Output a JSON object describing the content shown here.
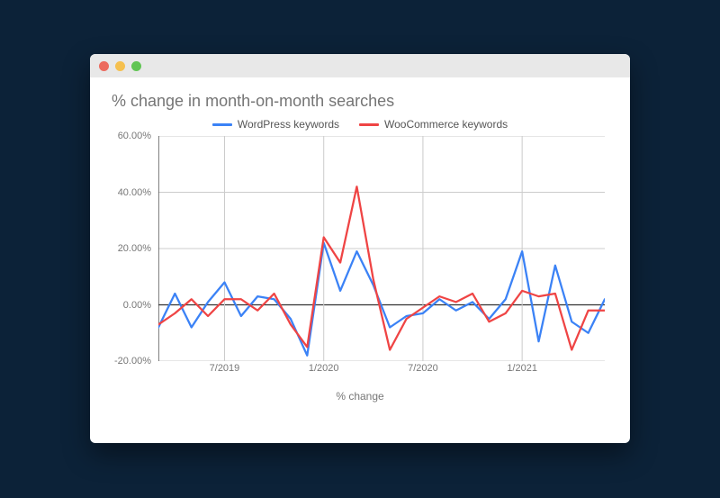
{
  "chart_data": {
    "type": "line",
    "title": "% change in month-on-month searches",
    "xlabel": "% change",
    "ylabel": "",
    "ylim": [
      -20,
      60
    ],
    "y_ticks": [
      -20,
      0,
      20,
      40,
      60
    ],
    "y_tick_labels": [
      "-20.00%",
      "0.00%",
      "20.00%",
      "40.00%",
      "60.00%"
    ],
    "categories": [
      "3/2019",
      "4/2019",
      "5/2019",
      "6/2019",
      "7/2019",
      "8/2019",
      "9/2019",
      "10/2019",
      "11/2019",
      "12/2019",
      "1/2020",
      "2/2020",
      "3/2020",
      "4/2020",
      "5/2020",
      "6/2020",
      "7/2020",
      "8/2020",
      "9/2020",
      "10/2020",
      "11/2020",
      "12/2020",
      "1/2021",
      "2/2021",
      "3/2021",
      "4/2021",
      "5/2021",
      "6/2021"
    ],
    "x_tick_indices": [
      4,
      10,
      16,
      22
    ],
    "x_tick_labels": [
      "7/2019",
      "1/2020",
      "7/2020",
      "1/2021"
    ],
    "series": [
      {
        "name": "WordPress keywords",
        "color": "#3b82f6",
        "values": [
          -8,
          4,
          -8,
          1,
          8,
          -4,
          3,
          2,
          -5,
          -18,
          22,
          5,
          19,
          7,
          -8,
          -4,
          -3,
          2,
          -2,
          1,
          -5,
          2,
          19,
          -13,
          14,
          -6,
          -10,
          2
        ]
      },
      {
        "name": "WooCommerce keywords",
        "color": "#ef4444",
        "values": [
          -7,
          -3,
          2,
          -4,
          2,
          2,
          -2,
          4,
          -7,
          -15,
          24,
          15,
          42,
          9,
          -16,
          -5,
          -1,
          3,
          1,
          4,
          -6,
          -3,
          5,
          3,
          4,
          -16,
          -2,
          -2
        ]
      }
    ]
  }
}
